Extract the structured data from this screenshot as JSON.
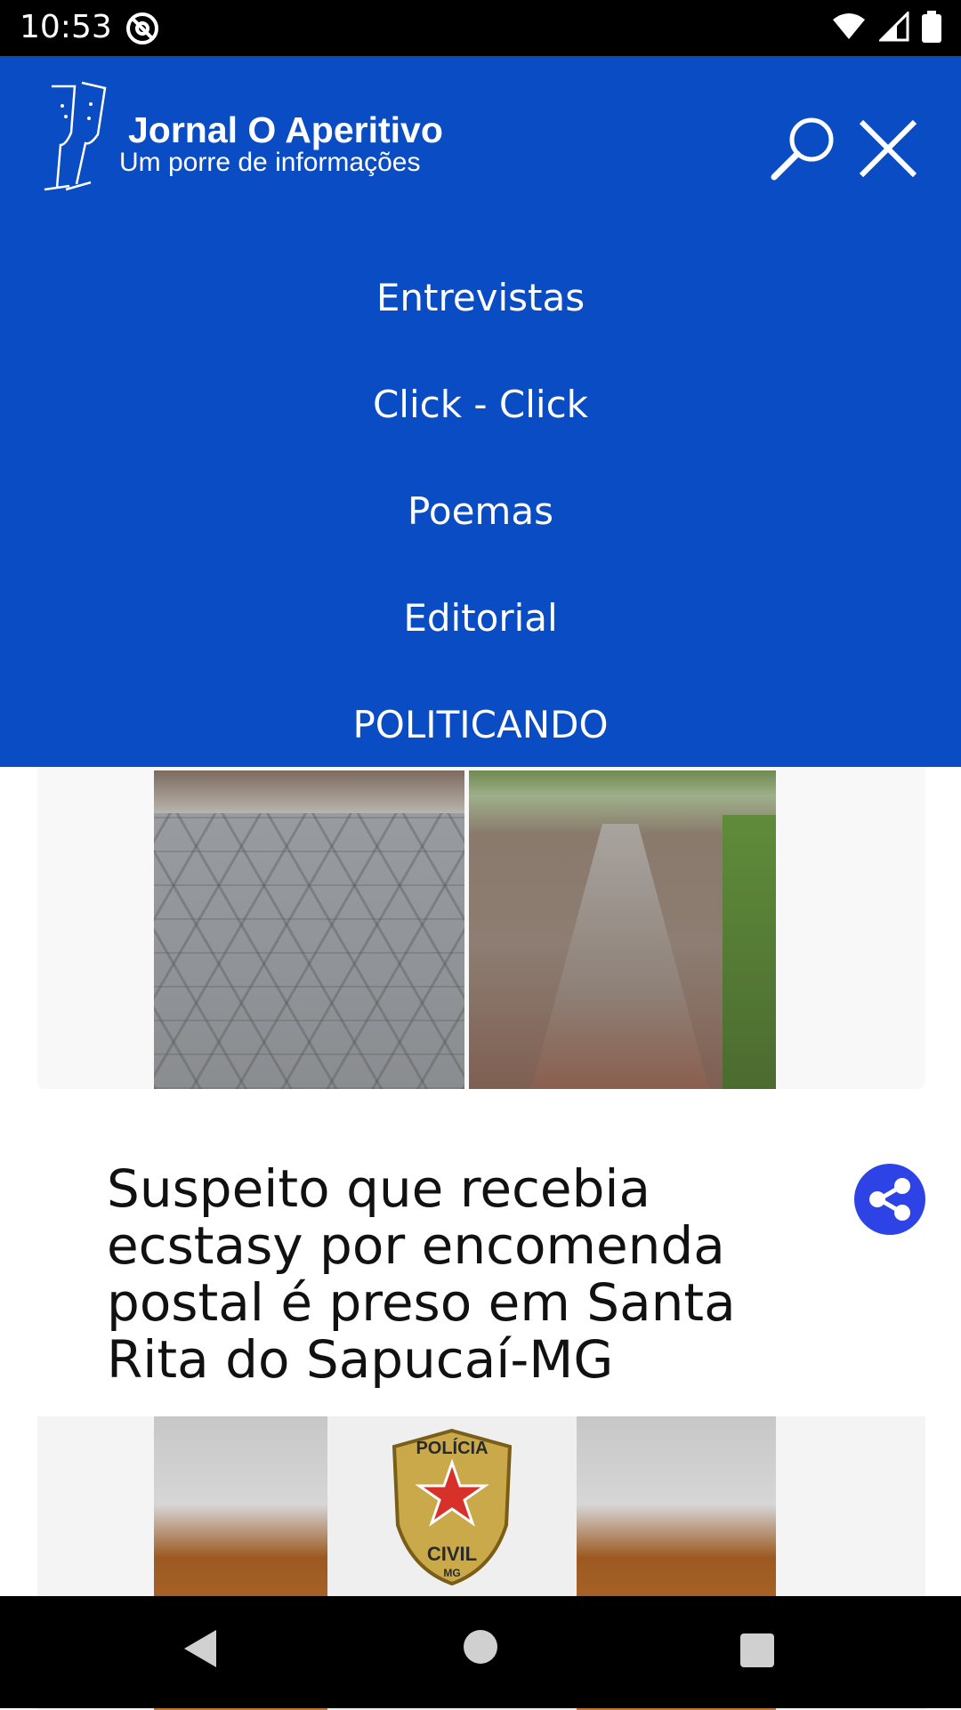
{
  "status_bar": {
    "time": "10:53"
  },
  "header": {
    "site_title": "Jornal O Aperitivo",
    "tagline": "Um porre de informações",
    "search_icon": "search-icon",
    "close_icon": "close-icon"
  },
  "menu": {
    "items": [
      {
        "label": "Entrevistas"
      },
      {
        "label": "Click - Click"
      },
      {
        "label": "Poemas"
      },
      {
        "label": "Editorial"
      },
      {
        "label": "POLITICANDO"
      }
    ]
  },
  "article": {
    "title": "Suspeito que recebia ecstasy por encomenda postal é preso em Santa Rita do Sapucaí-MG",
    "share_icon": "share-icon",
    "badge_text_top": "POLÍCIA",
    "badge_text_bottom": "CIVIL",
    "badge_state": "MG"
  },
  "colors": {
    "menu_background": "#0a4cc3",
    "share_button": "#2e43e6"
  }
}
